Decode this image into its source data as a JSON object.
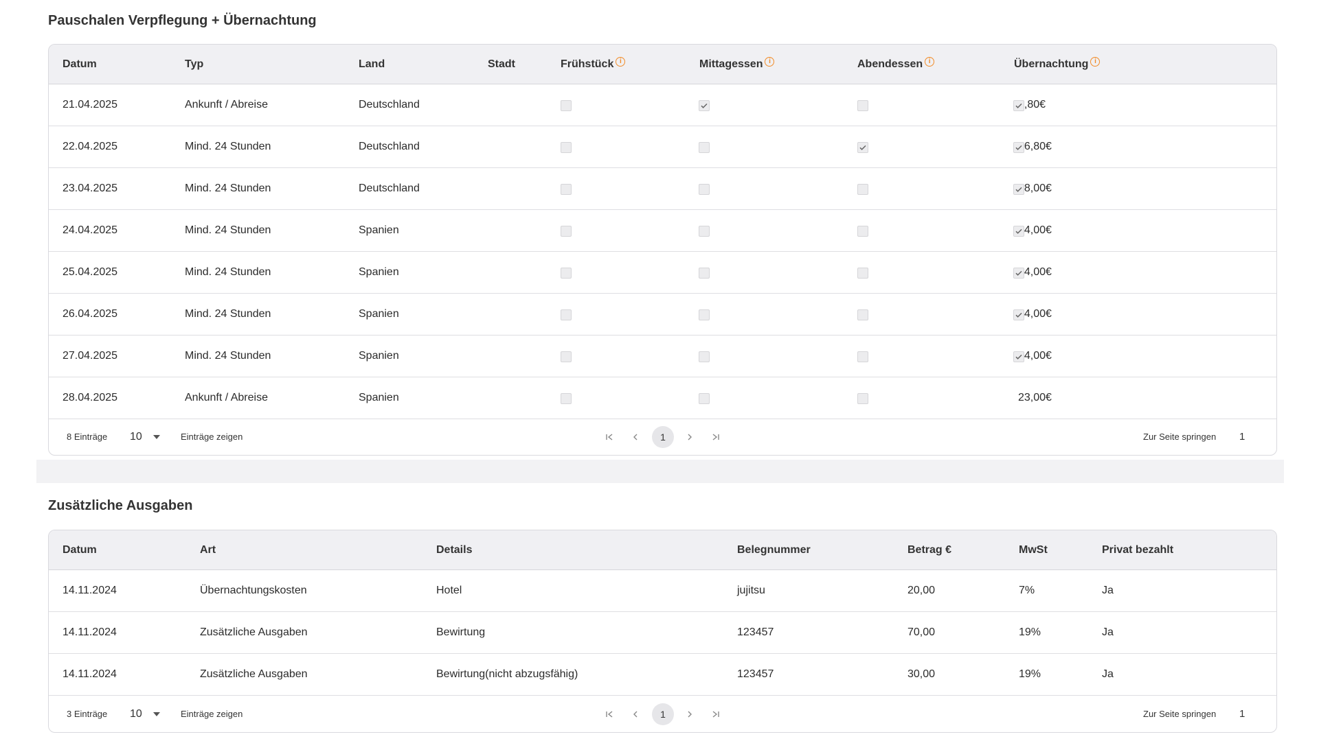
{
  "accent": "#f28c28",
  "section1": {
    "title": "Pauschalen Verpflegung + Übernachtung",
    "headers": {
      "datum": "Datum",
      "typ": "Typ",
      "land": "Land",
      "stadt": "Stadt",
      "fruehstueck": "Frühstück",
      "mittagessen": "Mittagessen",
      "abendessen": "Abendessen",
      "uebernachtung": "Übernachtung"
    },
    "rows": [
      {
        "datum": "21.04.2025",
        "typ": "Ankunft / Abreise",
        "land": "Deutschland",
        "stadt": "",
        "fruehstueck": false,
        "mittagessen": true,
        "abendessen": false,
        "uebernachtung": true,
        "betrag": "2,80€"
      },
      {
        "datum": "22.04.2025",
        "typ": "Mind. 24 Stunden",
        "land": "Deutschland",
        "stadt": "",
        "fruehstueck": false,
        "mittagessen": false,
        "abendessen": true,
        "uebernachtung": true,
        "betrag": "16,80€"
      },
      {
        "datum": "23.04.2025",
        "typ": "Mind. 24 Stunden",
        "land": "Deutschland",
        "stadt": "",
        "fruehstueck": false,
        "mittagessen": false,
        "abendessen": false,
        "uebernachtung": true,
        "betrag": "28,00€"
      },
      {
        "datum": "24.04.2025",
        "typ": "Mind. 24 Stunden",
        "land": "Spanien",
        "stadt": "",
        "fruehstueck": false,
        "mittagessen": false,
        "abendessen": false,
        "uebernachtung": true,
        "betrag": "34,00€"
      },
      {
        "datum": "25.04.2025",
        "typ": "Mind. 24 Stunden",
        "land": "Spanien",
        "stadt": "",
        "fruehstueck": false,
        "mittagessen": false,
        "abendessen": false,
        "uebernachtung": true,
        "betrag": "34,00€"
      },
      {
        "datum": "26.04.2025",
        "typ": "Mind. 24 Stunden",
        "land": "Spanien",
        "stadt": "",
        "fruehstueck": false,
        "mittagessen": false,
        "abendessen": false,
        "uebernachtung": true,
        "betrag": "34,00€"
      },
      {
        "datum": "27.04.2025",
        "typ": "Mind. 24 Stunden",
        "land": "Spanien",
        "stadt": "",
        "fruehstueck": false,
        "mittagessen": false,
        "abendessen": false,
        "uebernachtung": true,
        "betrag": "34,00€"
      },
      {
        "datum": "28.04.2025",
        "typ": "Ankunft / Abreise",
        "land": "Spanien",
        "stadt": "",
        "fruehstueck": false,
        "mittagessen": false,
        "abendessen": false,
        "uebernachtung": null,
        "betrag": "23,00€"
      }
    ],
    "footer": {
      "count": "8 Einträge",
      "page_size": "10",
      "show_label": "Einträge zeigen",
      "current_page": "1",
      "jump_label": "Zur Seite springen",
      "jump_value": "1"
    }
  },
  "section2": {
    "title": "Zusätzliche Ausgaben",
    "headers": {
      "datum": "Datum",
      "art": "Art",
      "details": "Details",
      "beleg": "Belegnummer",
      "betrag": "Betrag €",
      "mwst": "MwSt",
      "privat": "Privat bezahlt"
    },
    "rows": [
      {
        "datum": "14.11.2024",
        "art": "Übernachtungskosten",
        "details": "Hotel",
        "beleg": "jujitsu",
        "betrag": "20,00",
        "mwst": "7%",
        "privat": "Ja"
      },
      {
        "datum": "14.11.2024",
        "art": "Zusätzliche Ausgaben",
        "details": "Bewirtung",
        "beleg": "123457",
        "betrag": "70,00",
        "mwst": "19%",
        "privat": "Ja"
      },
      {
        "datum": "14.11.2024",
        "art": "Zusätzliche Ausgaben",
        "details": "Bewirtung(nicht abzugsfähig)",
        "beleg": "123457",
        "betrag": "30,00",
        "mwst": "19%",
        "privat": "Ja"
      }
    ],
    "footer": {
      "count": "3 Einträge",
      "page_size": "10",
      "show_label": "Einträge zeigen",
      "current_page": "1",
      "jump_label": "Zur Seite springen",
      "jump_value": "1"
    }
  }
}
